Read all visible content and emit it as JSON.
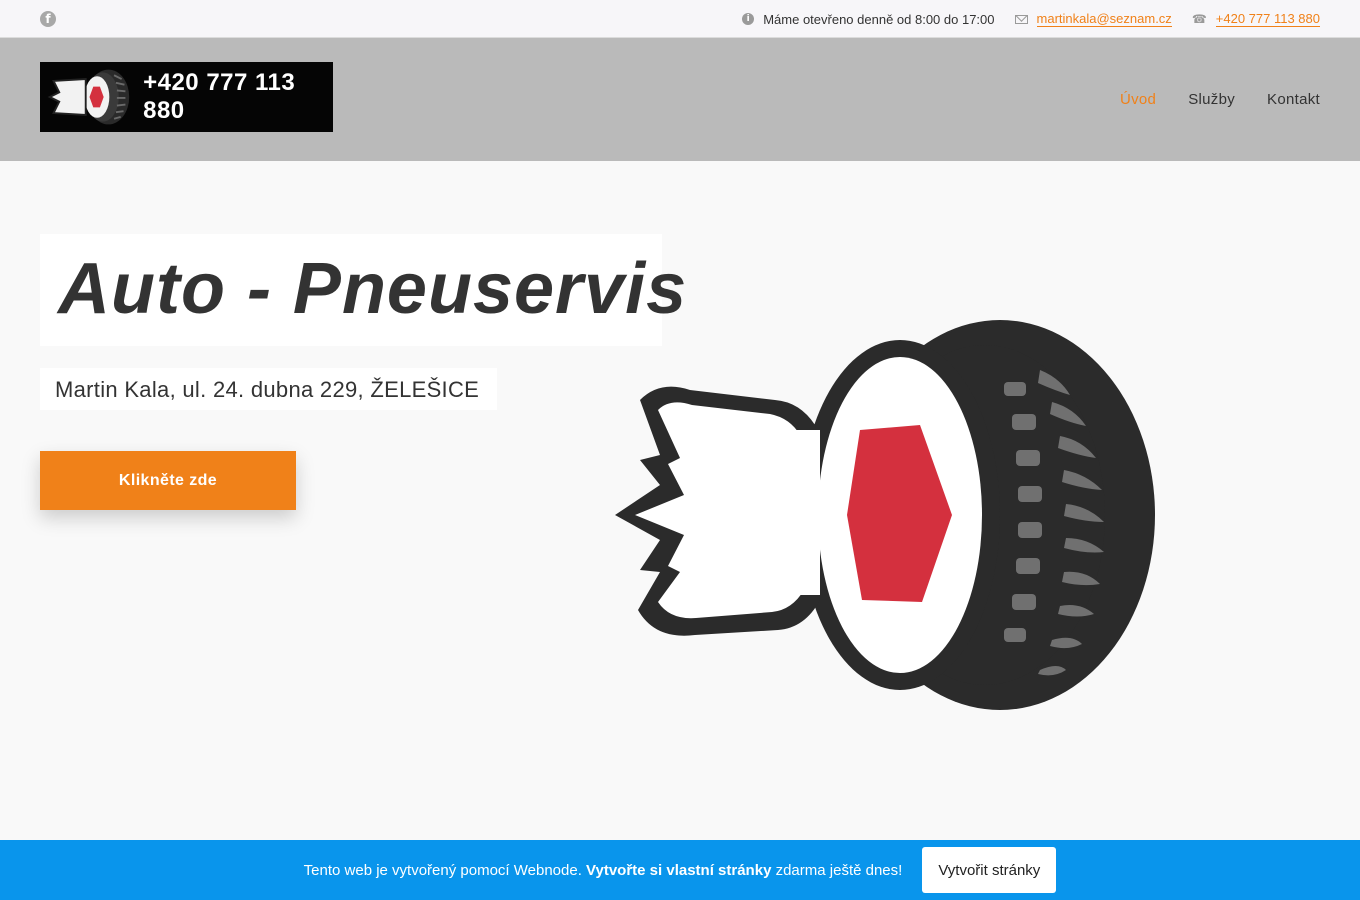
{
  "topbar": {
    "facebook_icon": "facebook-icon",
    "hours": "Máme otevřeno denně od 8:00 do 17:00",
    "email": "martinkala@seznam.cz",
    "phone": "+420 777 113 880"
  },
  "header": {
    "logo_phone": "+420 777 113 880",
    "nav": [
      {
        "label": "Úvod",
        "active": true
      },
      {
        "label": "Služby",
        "active": false
      },
      {
        "label": "Kontakt",
        "active": false
      }
    ]
  },
  "hero": {
    "title": "Auto -  Pneuservis",
    "subtitle": "Martin Kala, ul. 24. dubna 229, ŽELEŠICE",
    "cta_label": "Klikněte zde"
  },
  "banner": {
    "text_before": "Tento web je vytvořený pomocí Webnode. ",
    "text_bold": "Vytvořte si vlastní stránky",
    "text_after": " zdarma ještě dnes!",
    "button_label": "Vytvořit stránky"
  },
  "colors": {
    "accent": "#f08119",
    "header_bg": "#bababa",
    "banner_bg": "#0995ec",
    "logo_red": "#d4303e"
  }
}
